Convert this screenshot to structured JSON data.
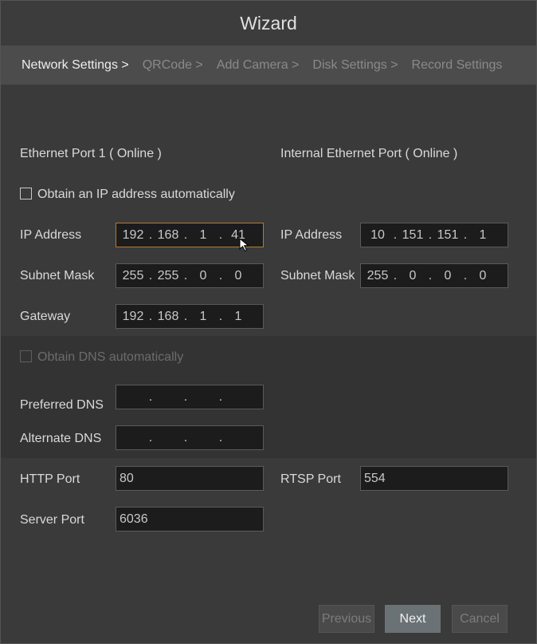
{
  "window": {
    "title": "Wizard"
  },
  "steps": [
    {
      "label": "Network Settings >",
      "active": true
    },
    {
      "label": "QRCode >",
      "active": false
    },
    {
      "label": "Add Camera >",
      "active": false
    },
    {
      "label": "Disk Settings >",
      "active": false
    },
    {
      "label": "Record Settings",
      "active": false
    }
  ],
  "port1": {
    "title": "Ethernet Port 1 ( Online )",
    "auto_ip_label": "Obtain an IP address automatically",
    "auto_ip_checked": false,
    "ip_label": "IP Address",
    "ip": [
      "192",
      "168",
      "1",
      "41"
    ],
    "mask_label": "Subnet Mask",
    "mask": [
      "255",
      "255",
      "0",
      "0"
    ],
    "gateway_label": "Gateway",
    "gateway": [
      "192",
      "168",
      "1",
      "1"
    ]
  },
  "internal": {
    "title": "Internal Ethernet Port ( Online )",
    "ip_label": "IP Address",
    "ip": [
      "10",
      "151",
      "151",
      "1"
    ],
    "mask_label": "Subnet Mask",
    "mask": [
      "255",
      "0",
      "0",
      "0"
    ]
  },
  "dns": {
    "auto_label": "Obtain DNS automatically",
    "auto_checked": false,
    "preferred_label": "Preferred DNS",
    "preferred": [
      "",
      "",
      "",
      ""
    ],
    "alternate_label": "Alternate DNS",
    "alternate": [
      "",
      "",
      "",
      ""
    ]
  },
  "ports": {
    "http_label": "HTTP Port",
    "http_value": "80",
    "rtsp_label": "RTSP Port",
    "rtsp_value": "554",
    "server_label": "Server Port",
    "server_value": "6036"
  },
  "buttons": {
    "previous": "Previous",
    "next": "Next",
    "cancel": "Cancel"
  },
  "colors": {
    "focus_border": "#b37a2e",
    "panel": "#3a3a3a",
    "step_bar": "#4c4c4c"
  }
}
